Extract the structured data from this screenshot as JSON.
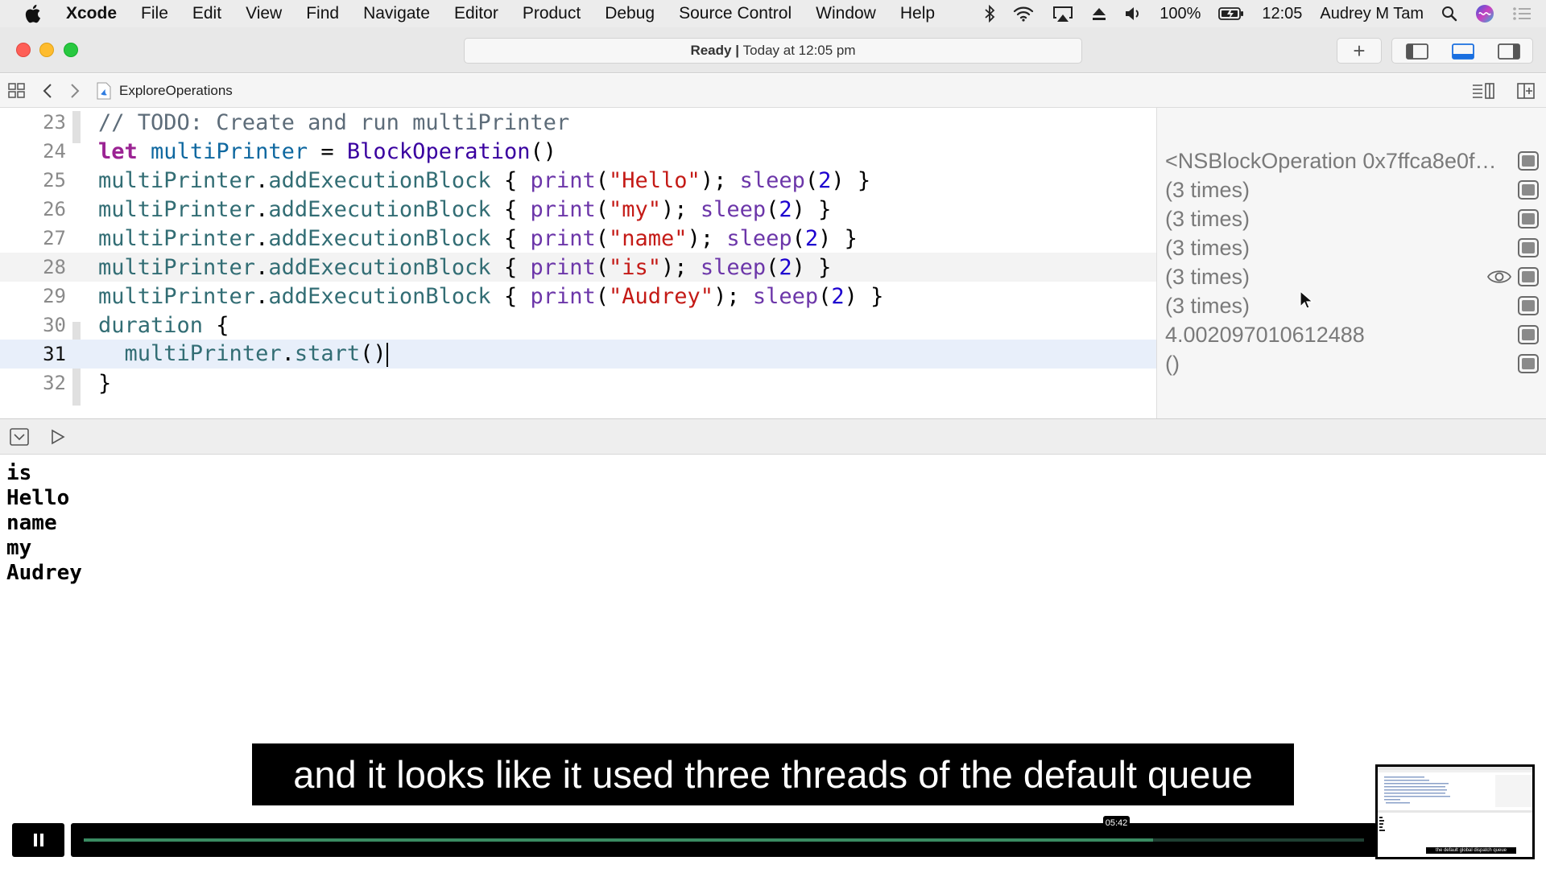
{
  "menubar": {
    "app_name": "Xcode",
    "items": [
      "File",
      "Edit",
      "View",
      "Find",
      "Navigate",
      "Editor",
      "Product",
      "Debug",
      "Source Control",
      "Window",
      "Help"
    ],
    "battery": "100%",
    "clock": "12:05",
    "user": "Audrey M Tam",
    "icons": [
      "apple-icon",
      "bluetooth-icon",
      "wifi-icon",
      "airplay-icon",
      "eject-icon",
      "volume-icon",
      "battery-icon",
      "spotlight-search-icon",
      "siri-icon",
      "notification-center-icon"
    ]
  },
  "window": {
    "status_ready": "Ready",
    "status_separator": " | ",
    "status_time": "Today at 12:05 pm",
    "add_button_label": "+"
  },
  "jumpbar": {
    "file_name": "ExploreOperations"
  },
  "editor": {
    "line_numbers": [
      "23",
      "24",
      "25",
      "26",
      "27",
      "28",
      "29",
      "30",
      "31",
      "32"
    ],
    "lines": [
      "// TODO: Create and run multiPrinter",
      "let multiPrinter = BlockOperation()",
      "multiPrinter.addExecutionBlock { print(\"Hello\"); sleep(2) }",
      "multiPrinter.addExecutionBlock { print(\"my\"); sleep(2) }",
      "multiPrinter.addExecutionBlock { print(\"name\"); sleep(2) }",
      "multiPrinter.addExecutionBlock { print(\"is\"); sleep(2) }",
      "multiPrinter.addExecutionBlock { print(\"Audrey\"); sleep(2) }",
      "duration {",
      "  multiPrinter.start()",
      "}"
    ],
    "current_line": "31"
  },
  "results": [
    "<NSBlockOperation 0x7ffca8e0f7...",
    "(3 times)",
    "(3 times)",
    "(3 times)",
    "(3 times)",
    "(3 times)",
    "4.002097010612488",
    "()"
  ],
  "console": {
    "output": [
      "is",
      "Hello",
      "name",
      "my",
      "Audrey"
    ]
  },
  "video": {
    "caption": "and it looks like it used three threads of the default queue",
    "timestamp": "05:42",
    "progress": 0.835,
    "thumbnail_caption": "the default global dispatch queue"
  },
  "colors": {
    "keyword": "#9b2393",
    "variable": "#0f68a0",
    "string": "#c41a16",
    "number": "#1c00cf",
    "comment": "#5d6c79",
    "progress": "#3a8b62"
  }
}
